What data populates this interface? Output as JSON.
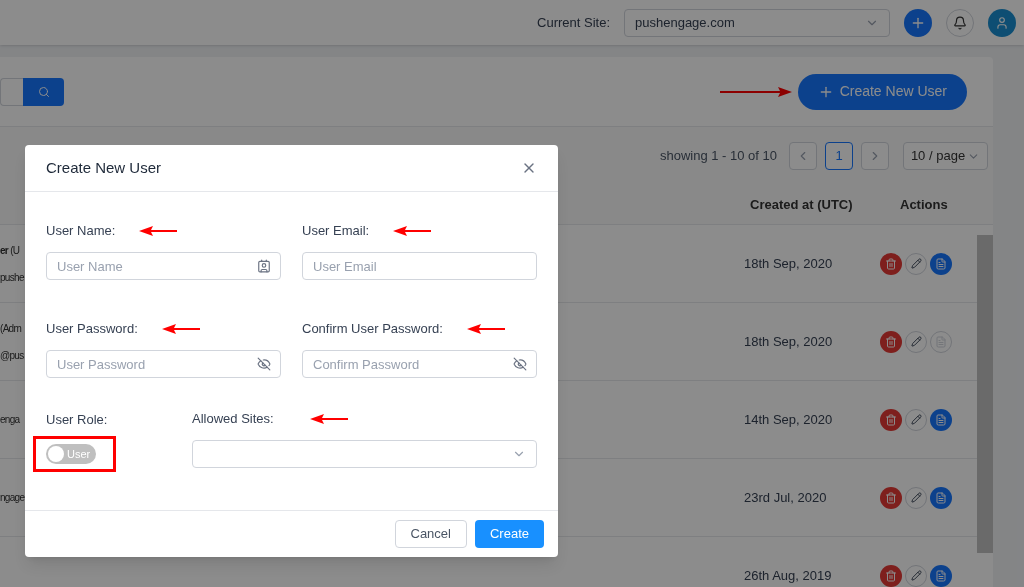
{
  "header": {
    "site_label": "Current Site:",
    "site_value": "pushengage.com"
  },
  "toolbar": {
    "create_button": "Create New User"
  },
  "pagination": {
    "summary": "showing 1 - 10 of 10",
    "pages": [
      {
        "label": "1",
        "selected": true
      }
    ],
    "page_size": "10 / page"
  },
  "table": {
    "columns": [
      "Created at (UTC)",
      "Actions"
    ],
    "rows": [
      {
        "name": "**er** (U",
        "email": "pushe",
        "created": "18th Sep, 2020",
        "report_enabled": true
      },
      {
        "name": "(Adm",
        "email": "@pus",
        "created": "18th Sep, 2020",
        "report_enabled": false
      },
      {
        "email": "enga",
        "created": "14th Sep, 2020",
        "report_enabled": true
      },
      {
        "email": "ngage",
        "created": "23rd Jul, 2020",
        "report_enabled": true
      },
      {
        "created": "26th Aug, 2019",
        "report_enabled": true
      }
    ]
  },
  "dialog": {
    "title": "Create New User",
    "fields": [
      {
        "label": "User Name:",
        "placeholder": "User Name",
        "kind": "name"
      },
      {
        "label": "User Email:",
        "placeholder": "User Email",
        "kind": "email"
      },
      {
        "label": "User Password:",
        "placeholder": "User Password",
        "kind": "password"
      },
      {
        "label": "Confirm User Password:",
        "placeholder": "Confirm Password",
        "kind": "password"
      }
    ],
    "role": {
      "label": "User Role:",
      "toggle_label": "User",
      "on": false
    },
    "sites": {
      "label": "Allowed Sites:"
    },
    "buttons": [
      {
        "label": "Cancel",
        "kind": "default"
      },
      {
        "label": "Create",
        "kind": "primary"
      }
    ]
  }
}
